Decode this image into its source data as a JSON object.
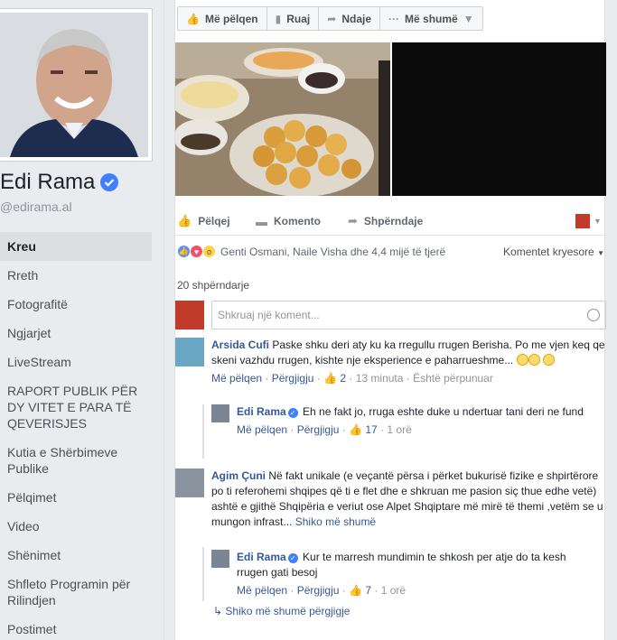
{
  "sidebar": {
    "name": "Edi Rama",
    "handle": "@edirama.al",
    "items": [
      {
        "label": "Kreu"
      },
      {
        "label": "Rreth"
      },
      {
        "label": "Fotografitë"
      },
      {
        "label": "Ngjarjet"
      },
      {
        "label": "LiveStream"
      },
      {
        "label": "RAPORT PUBLIK PËR DY VITET E PARA TË QEVERISJES"
      },
      {
        "label": "Kutia e Shërbimeve Publike"
      },
      {
        "label": "Pëlqimet"
      },
      {
        "label": "Video"
      },
      {
        "label": "Shënimet"
      },
      {
        "label": "Shfleto Programin për Rilindjen"
      },
      {
        "label": "Postimet"
      }
    ]
  },
  "toolbar": {
    "like": "Më pëlqen",
    "save": "Ruaj",
    "share": "Ndaje",
    "more": "Më shumë"
  },
  "post_actions": {
    "like": "Pëlqej",
    "comment": "Komento",
    "share": "Shpërndaje"
  },
  "reactions": {
    "text": "Genti Osmani, Naile Visha dhe 4,4 mijë të tjerë",
    "sort": "Komentet kryesore"
  },
  "shares": "20 shpërndarje",
  "composer": {
    "placeholder": "Shkruaj një koment..."
  },
  "comments": [
    {
      "author": "Arsida Cufi",
      "text": "Paske shku deri aty ku ka rregullu rrugen Berisha. Po me vjen keq qe skeni vazhdu rrugen, kishte nje eksperience e paharrueshme...",
      "like": "Më pëlqen",
      "reply": "Përgjigju",
      "likes": "2",
      "time": "13 minuta",
      "edited": "Është përpunuar",
      "reply_comment": {
        "author": "Edi Rama",
        "text": "Eh ne fakt jo, rruga eshte duke u ndertuar tani deri ne fund",
        "like": "Më pëlqen",
        "reply": "Përgjigju",
        "likes": "17",
        "time": "1 orë"
      }
    },
    {
      "author": "Agim Çuni",
      "text": "Në fakt unikale (e veçantë përsa i përket bukurisë fizike e shpirtërore po ti referohemi shqipes që ti e flet dhe e shkruan me pasion siç thue edhe vetë) ashtë e gjithë Shqipëria e veriut ose Alpet Shqiptare më mirë të themi ,vetëm se u mungon infrast...",
      "see_more": "Shiko më shumë",
      "reply_comment": {
        "author": "Edi Rama",
        "text": "Kur te marresh mundimin te shkosh per atje do ta kesh rrugen gati besoj",
        "like": "Më pëlqen",
        "reply": "Përgjigju",
        "likes": "7",
        "time": "1 orë"
      }
    }
  ],
  "more_replies": "Shiko më shumë përgjigje"
}
